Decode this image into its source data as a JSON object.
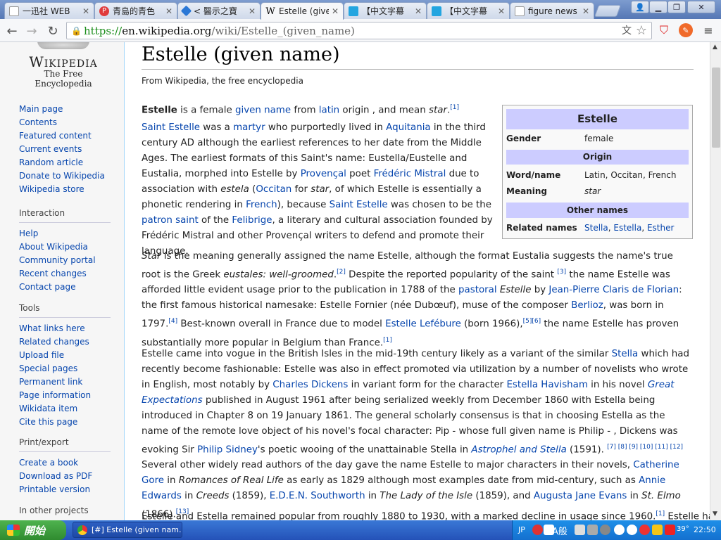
{
  "tabs": [
    {
      "label": "一迅社 WEB",
      "icon": "page-icon",
      "color": "#ffffff"
    },
    {
      "label": "青島的青色",
      "icon": "pixnet-icon",
      "color": "#e03b3b"
    },
    {
      "label": "< 醫示之寶",
      "icon": "diamond-icon",
      "color": "#2b78d6"
    },
    {
      "label": "Estelle (given",
      "icon": "wikipedia-icon",
      "color": "#ffffff"
    },
    {
      "label": "【中文字幕",
      "icon": "bilibili-icon",
      "color": "#23a5e0"
    },
    {
      "label": "【中文字幕",
      "icon": "bilibili-icon",
      "color": "#23a5e0"
    },
    {
      "label": "figure news",
      "icon": "page-icon",
      "color": "#ffffff"
    }
  ],
  "toolbar": {
    "url_scheme": "https://",
    "url_host": "en.wikipedia.org",
    "url_path": "/wiki/Estelle_(given_name)"
  },
  "sidebar": {
    "logo_word": "Wikipedia",
    "logo_slogan": "The Free Encyclopedia",
    "nav": [
      "Main page",
      "Contents",
      "Featured content",
      "Current events",
      "Random article",
      "Donate to Wikipedia",
      "Wikipedia store"
    ],
    "interaction_heading": "Interaction",
    "interaction": [
      "Help",
      "About Wikipedia",
      "Community portal",
      "Recent changes",
      "Contact page"
    ],
    "tools_heading": "Tools",
    "tools": [
      "What links here",
      "Related changes",
      "Upload file",
      "Special pages",
      "Permanent link",
      "Page information",
      "Wikidata item",
      "Cite this page"
    ],
    "print_heading": "Print/export",
    "print": [
      "Create a book",
      "Download as PDF",
      "Printable version"
    ],
    "other_heading": "In other projects"
  },
  "article": {
    "title": "Estelle (given name)",
    "from": "From Wikipedia, the free encyclopedia"
  },
  "infobox": {
    "title": "Estelle",
    "gender_label": "Gender",
    "gender_value": "female",
    "origin_heading": "Origin",
    "word_label": "Word/name",
    "word_value": "Latin, Occitan, French",
    "meaning_label": "Meaning",
    "meaning_value": "star",
    "other_heading": "Other names",
    "related_label": "Related names",
    "related_value": [
      "Stella",
      "Estella",
      "Esther"
    ]
  },
  "taskbar": {
    "start_label": "開始",
    "task_label": "[#] Estelle (given nam...",
    "lang": "JP",
    "ime": "A般",
    "temp": "39°",
    "clock": "22:50"
  }
}
